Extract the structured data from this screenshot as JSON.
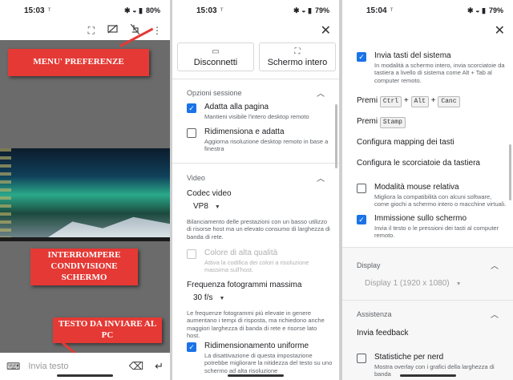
{
  "panel1": {
    "status": {
      "time": "15:03",
      "sub": "ᵀ",
      "icons": "✱ ◒ ▮",
      "battery": "80%"
    },
    "toolbar_icons": [
      "fullscreen-icon",
      "hide-icon",
      "disconnect-icon",
      "more-icon"
    ],
    "callouts": {
      "menu": "MENU' PREFERENZE",
      "interrupt": "INTERROMPERE CONDIVISIONE SCHERMO",
      "text": "TESTO DA INVIARE AL PC"
    },
    "input_placeholder": "Invia testo"
  },
  "panel2": {
    "status": {
      "time": "15:03",
      "sub": "ᵀ",
      "icons": "✱ ◒ ▮",
      "battery": "79%"
    },
    "disconnect_label": "Disconnetti",
    "fullscreen_label": "Schermo intero",
    "session_section": "Opzioni sessione",
    "fit_title": "Adatta alla pagina",
    "fit_desc": "Mantieni visibile l'intero desktop remoto",
    "resize_title": "Ridimensiona e adatta",
    "resize_desc": "Aggiorna risoluzione desktop remoto in base a finestra",
    "video_section": "Video",
    "codec_label": "Codec video",
    "codec_value": "VP8",
    "codec_desc": "Bilanciamento delle prestazioni con un basso utilizzo di risorse host ma un elevato consumo di larghezza di banda di rete.",
    "hq_title": "Colore di alta qualità",
    "hq_desc": "Attiva la codifica dei colori a risoluzione massima sull'host.",
    "fps_label": "Frequenza fotogrammi massima",
    "fps_value": "30 f/s",
    "fps_desc": "Le frequenze fotogrammi più elevate in genere aumentano i tempi di risposta, ma richiedono anche maggiori larghezza di banda di rete e risorse lato host.",
    "uniform_title": "Ridimensionamento uniforme",
    "uniform_desc": "La disattivazione di questa impostazione potrebbe migliorare la nitidezza del testo su uno schermo ad alta risoluzione"
  },
  "panel3": {
    "status": {
      "time": "15:04",
      "sub": "ᵀ",
      "icons": "✱ ◒ ▮",
      "battery": "79%"
    },
    "syskeys_title": "Invia tasti del sistema",
    "syskeys_desc": "In modalità a schermo intero, invia scorciatoie da tastiera a livello di sistema come Alt + Tab al computer remoto.",
    "press_label": "Premi",
    "keys1": [
      "Ctrl",
      "Alt",
      "Canc"
    ],
    "plus": "+",
    "keys2": [
      "Stamp"
    ],
    "mapping_link": "Configura mapping dei tasti",
    "shortcuts_link": "Configura le scorciatoie da tastiera",
    "relmouse_title": "Modalità mouse relativa",
    "relmouse_desc": "Migliora la compatibilità con alcuni software, come giochi a schermo intero o macchine virtuali.",
    "input_title": "Immissione sullo schermo",
    "input_desc": "Invia il testo o le pressioni dei tasti al computer remoto.",
    "display_section": "Display",
    "display_value": "Display 1 (1920 x 1080)",
    "help_section": "Assistenza",
    "feedback_link": "Invia feedback",
    "stats_title": "Statistiche per nerd",
    "stats_desc": "Mostra overlay con i grafici della larghezza di banda"
  },
  "colors": {
    "accent": "#1a73e8",
    "callout": "#e53935"
  }
}
